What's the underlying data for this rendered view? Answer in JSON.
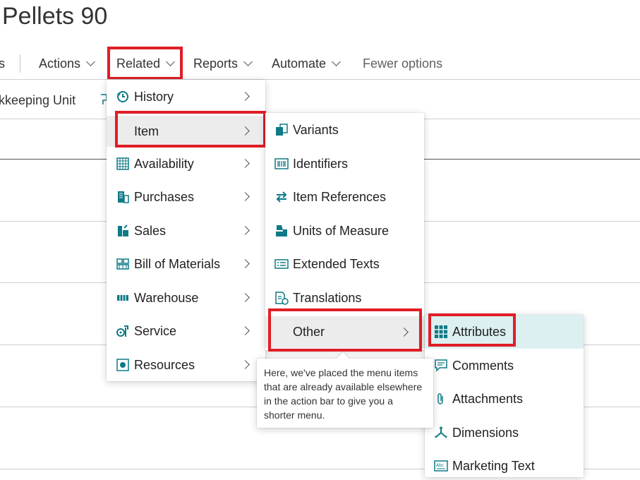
{
  "page_title": "Pellets 90",
  "action_bar": {
    "partial_left": "s",
    "actions": "Actions",
    "related": "Related",
    "reports": "Reports",
    "automate": "Automate",
    "fewer_options": "Fewer options"
  },
  "sub_bar": {
    "partial_label": "kkeeping Unit"
  },
  "related_menu": {
    "items": [
      {
        "label": "History",
        "icon": "history-icon"
      },
      {
        "label": "Item",
        "icon": "none"
      },
      {
        "label": "Availability",
        "icon": "availability-icon"
      },
      {
        "label": "Purchases",
        "icon": "purchases-icon"
      },
      {
        "label": "Sales",
        "icon": "sales-icon"
      },
      {
        "label": "Bill of Materials",
        "icon": "bill-of-materials-icon"
      },
      {
        "label": "Warehouse",
        "icon": "warehouse-icon"
      },
      {
        "label": "Service",
        "icon": "service-icon"
      },
      {
        "label": "Resources",
        "icon": "resources-icon"
      }
    ]
  },
  "item_menu": {
    "items": [
      {
        "label": "Variants",
        "icon": "variants-icon"
      },
      {
        "label": "Identifiers",
        "icon": "barcode-icon"
      },
      {
        "label": "Item References",
        "icon": "arrows-exchange-icon"
      },
      {
        "label": "Units of Measure",
        "icon": "units-of-measure-icon"
      },
      {
        "label": "Extended Texts",
        "icon": "extended-texts-icon"
      },
      {
        "label": "Translations",
        "icon": "translations-icon"
      },
      {
        "label": "Other",
        "icon": "none"
      }
    ]
  },
  "other_menu": {
    "items": [
      {
        "label": "Attributes",
        "icon": "grid-icon"
      },
      {
        "label": "Comments",
        "icon": "comment-icon"
      },
      {
        "label": "Attachments",
        "icon": "paperclip-icon"
      },
      {
        "label": "Dimensions",
        "icon": "dimensions-icon"
      },
      {
        "label": "Marketing Text",
        "icon": "marketing-text-icon"
      }
    ]
  },
  "tooltip": "Here, we've placed the menu items that are already available elsewhere in the action bar to give you a shorter menu.",
  "colors": {
    "accent": "#0e7a86",
    "highlight_red": "#e01e26",
    "hover_bg": "#dceff1",
    "selected_bg": "#ececec"
  }
}
